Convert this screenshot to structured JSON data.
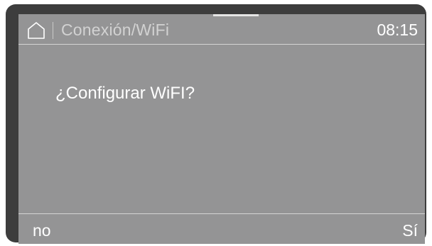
{
  "header": {
    "home_icon": "home-icon",
    "title": "Conexión/WiFi",
    "time": "08:15"
  },
  "dialog": {
    "question": "¿Configurar WiFI?"
  },
  "footer": {
    "left_label": "no",
    "right_label": "Sí"
  },
  "colors": {
    "screen_bg": "#949495",
    "bezel": "#3d3d3d",
    "text": "#ffffff",
    "breadcrumb_text": "#d2d2d2"
  }
}
